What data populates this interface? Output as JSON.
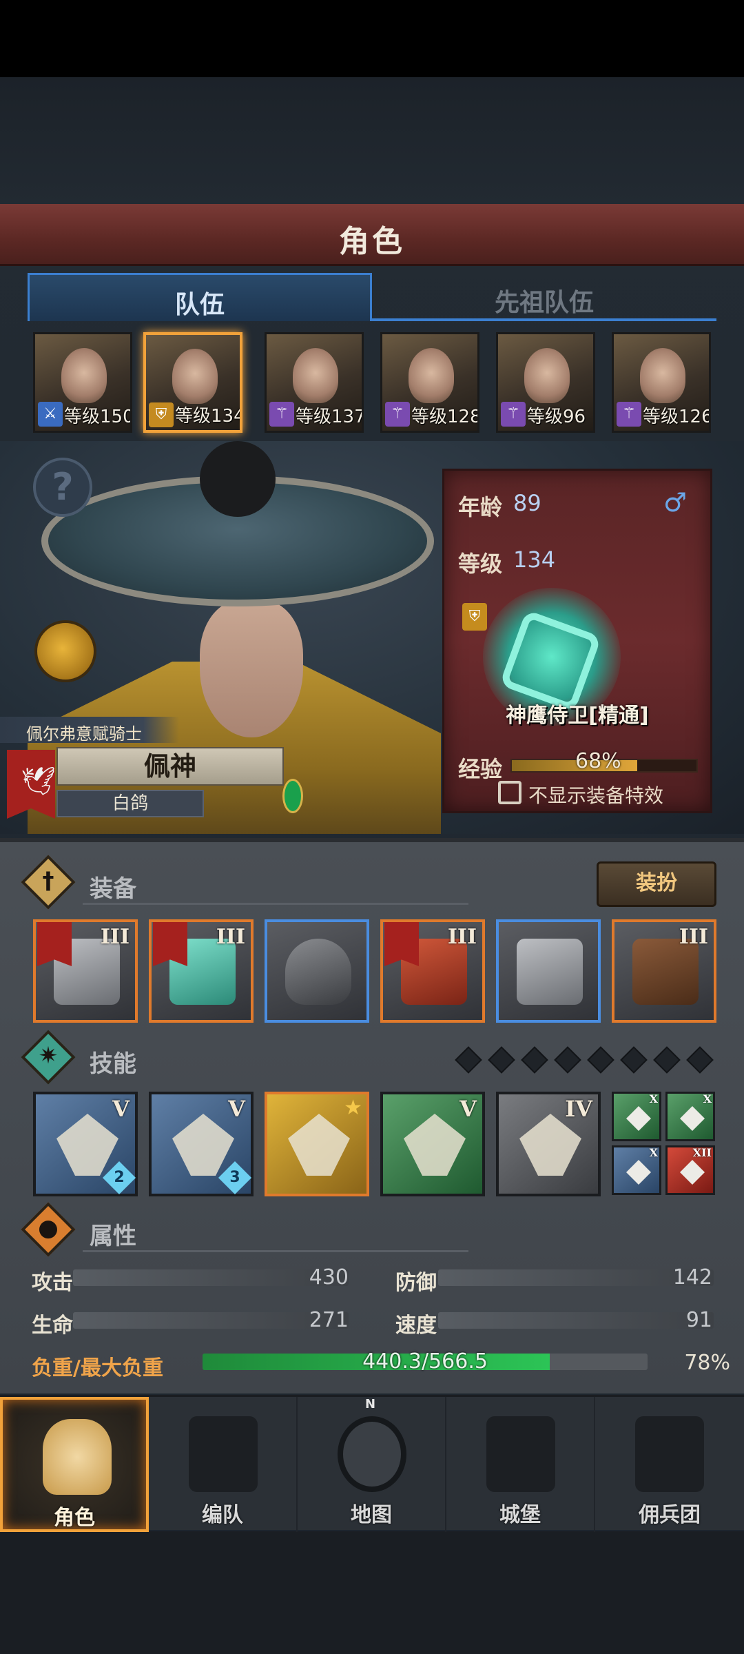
{
  "header": {
    "title": "角色"
  },
  "tabs": [
    {
      "label": "队伍",
      "active": true
    },
    {
      "label": "先祖队伍",
      "active": false
    }
  ],
  "party": [
    {
      "level": "等级150",
      "type_icon": "sword-icon",
      "selected": false
    },
    {
      "level": "等级134",
      "type_icon": "shield-icon",
      "selected": true
    },
    {
      "level": "等级137",
      "type_icon": "staff-icon",
      "selected": false
    },
    {
      "level": "等级128",
      "type_icon": "staff-icon",
      "selected": false
    },
    {
      "level": "等级96",
      "type_icon": "staff-icon",
      "selected": false
    },
    {
      "level": "等级126",
      "type_icon": "staff-icon",
      "selected": false
    }
  ],
  "hero": {
    "help_icon": "?",
    "title": "佩尔弗意赋骑士",
    "name": "佩神",
    "subtitle": "白鸽"
  },
  "info": {
    "age_label": "年龄",
    "age": "89",
    "gender_icon": "♂",
    "level_label": "等级",
    "level": "134",
    "class_name": "神鹰侍卫[精通]",
    "exp_label": "经验",
    "exp_percent": 68,
    "exp_text": "68%",
    "hide_effects_label": "不显示装备特效"
  },
  "equipment": {
    "title": "装备",
    "dress_button": "装扮",
    "slots": [
      {
        "tier": "III",
        "has_flag": true,
        "icon": "crossbow-icon"
      },
      {
        "tier": "III",
        "has_flag": true,
        "icon": "shield-icon"
      },
      {
        "tier": "",
        "has_flag": false,
        "icon": "helmet-icon"
      },
      {
        "tier": "III",
        "has_flag": true,
        "icon": "armor-icon"
      },
      {
        "tier": "",
        "has_flag": false,
        "icon": "boots-icon"
      },
      {
        "tier": "III",
        "has_flag": false,
        "icon": "book-icon"
      }
    ]
  },
  "skills": {
    "title": "技能",
    "list": [
      {
        "tier": "V",
        "badge": "2",
        "icon": "sword-summon-icon"
      },
      {
        "tier": "V",
        "badge": "3",
        "icon": "wing-slash-icon"
      },
      {
        "tier": "★",
        "badge": "",
        "icon": "shield-break-icon"
      },
      {
        "tier": "V",
        "badge": "",
        "icon": "crystal-burst-icon"
      },
      {
        "tier": "IV",
        "badge": "",
        "icon": "crystal-hand-icon"
      }
    ],
    "mini": [
      {
        "tier": "X",
        "icon": "burst-icon"
      },
      {
        "tier": "X",
        "icon": "fist-icon"
      },
      {
        "tier": "X",
        "icon": "bird-icon"
      },
      {
        "tier": "XII",
        "icon": "sword-icon"
      }
    ]
  },
  "attributes": {
    "title": "属性",
    "attack_label": "攻击",
    "attack": "430",
    "defense_label": "防御",
    "defense": "142",
    "hp_label": "生命",
    "hp": "271",
    "speed_label": "速度",
    "speed": "91",
    "load_label": "负重/最大负重",
    "load_text": "440.3/566.5",
    "load_percent": 78,
    "load_percent_text": "78%"
  },
  "nav": [
    {
      "label": "角色",
      "icon": "knight-icon",
      "active": true
    },
    {
      "label": "编队",
      "icon": "formation-icon",
      "active": false
    },
    {
      "label": "地图",
      "icon": "compass-icon",
      "active": false
    },
    {
      "label": "城堡",
      "icon": "castle-icon",
      "active": false
    },
    {
      "label": "佣兵团",
      "icon": "mercenary-icon",
      "active": false
    }
  ],
  "compass_letter": "N",
  "colors": {
    "accent": "#f2a23a",
    "tab_blue": "#3b7fd0",
    "load_green": "#2cc456",
    "load_label": "#f0a44a"
  }
}
